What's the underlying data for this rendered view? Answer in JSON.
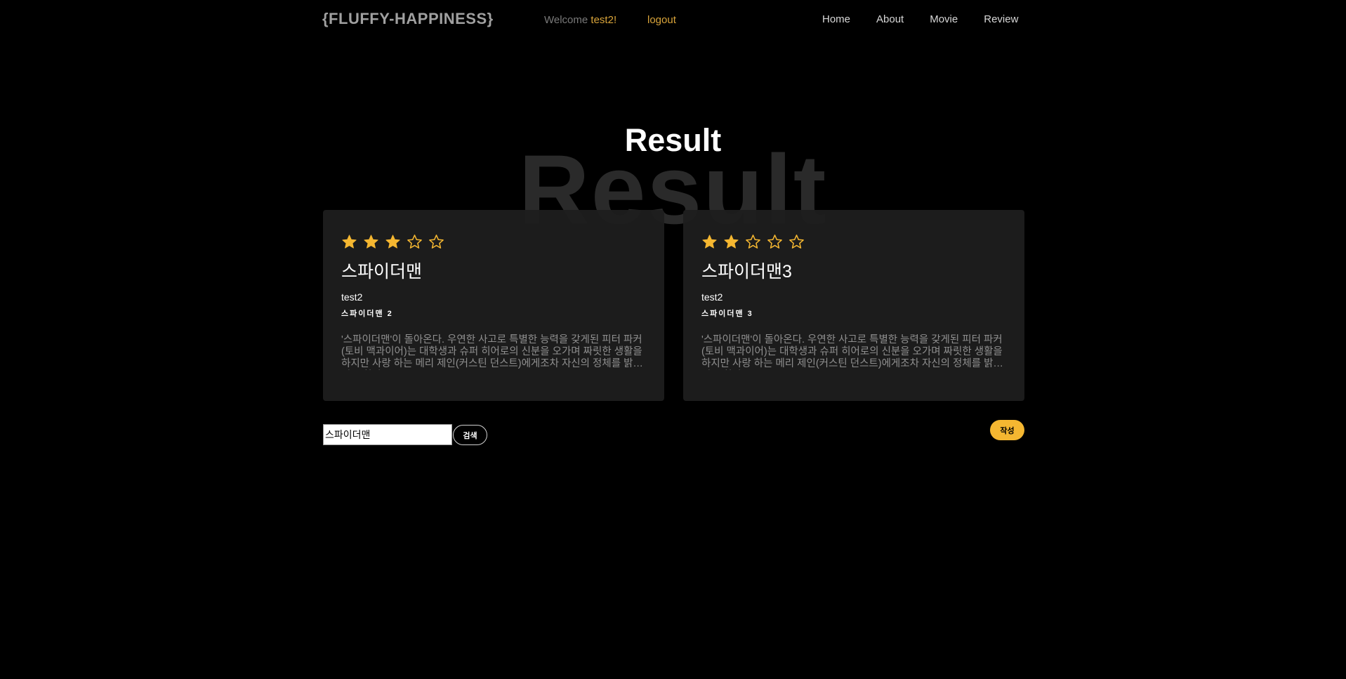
{
  "header": {
    "logo": "{FLUFFY-HAPPINESS}",
    "welcome_prefix": "Welcome ",
    "username": "test2!",
    "logout_label": "logout",
    "nav": [
      "Home",
      "About",
      "Movie",
      "Review"
    ]
  },
  "page": {
    "title": "Result",
    "title_background": "Result"
  },
  "reviews": [
    {
      "rating": 3,
      "max_rating": 5,
      "title": "스파이더맨",
      "author": "test2",
      "movie": "스파이더맨 2",
      "body": "'스파이더맨'이 돌아온다. 우연한 사고로 특별한 능력을 갖게된 피터 파커(토비 맥과이어)는 대학생과 슈퍼 히어로의 신분을 오가며 짜릿한 생활을 하지만 사랑 하는 메리 제인(커스틴 던스트)에게조차 자신의 정체를 밝히지 못한다."
    },
    {
      "rating": 2,
      "max_rating": 5,
      "title": "스파이더맨3",
      "author": "test2",
      "movie": "스파이더맨 3",
      "body": "'스파이더맨'이 돌아온다. 우연한 사고로 특별한 능력을 갖게된 피터 파커(토비 맥과이어)는 대학생과 슈퍼 히어로의 신분을 오가며 짜릿한 생활을 하지만 사랑 하는 메리 제인(커스틴 던스트)에게조차 자신의 정체를 밝히지 못한다."
    }
  ],
  "search": {
    "value": "스파이더맨",
    "button_label": "검색"
  },
  "write_button_label": "작성",
  "colors": {
    "accent": "#f5b731",
    "link": "#d9a43a",
    "card_bg": "#1e1e1e",
    "page_bg": "#000000"
  }
}
